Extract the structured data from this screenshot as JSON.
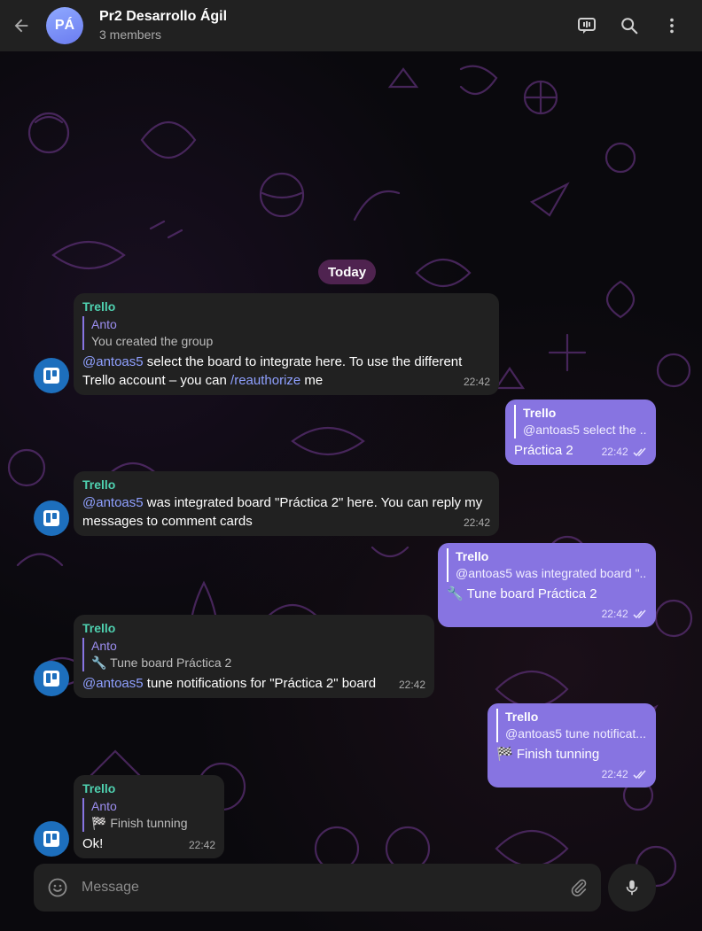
{
  "header": {
    "back_icon": "arrow-left-icon",
    "avatar_initials": "PÁ",
    "title": "Pr2 Desarrollo Ágil",
    "subtitle": "3 members",
    "actions": [
      "live-stream-icon",
      "search-icon",
      "more-vertical-icon"
    ]
  },
  "date_separator": "Today",
  "messages": [
    {
      "sender": "Trello",
      "reply_name": "Anto",
      "reply_text": "You created the group",
      "mention": "@antoas5",
      "text_a": " select the board to integrate here. To use the different Trello account – you can ",
      "command": "/reauthorize",
      "text_b": " me",
      "time": "22:42"
    },
    {
      "reply_name": "Trello",
      "reply_text": "@antoas5 select the ...",
      "text": "Práctica 2",
      "time": "22:42"
    },
    {
      "sender": "Trello",
      "mention": "@antoas5",
      "text_a": " was integrated board \"Práctica 2\" here. You can reply my messages to comment cards",
      "time": "22:42"
    },
    {
      "reply_name": "Trello",
      "reply_text": "@antoas5 was integrated board \"...",
      "text": "🔧 Tune board Práctica 2",
      "time": "22:42"
    },
    {
      "sender": "Trello",
      "reply_name": "Anto",
      "reply_text": "🔧 Tune board Práctica 2",
      "mention": "@antoas5",
      "text_a": " tune notifications for \"Práctica 2\" board",
      "time": "22:42"
    },
    {
      "reply_name": "Trello",
      "reply_text": "@antoas5 tune notificat...",
      "text": "🏁 Finish tunning",
      "time": "22:42"
    },
    {
      "sender": "Trello",
      "reply_name": "Anto",
      "reply_text": "🏁 Finish tunning",
      "text": "Ok!",
      "time": "22:42"
    }
  ],
  "composer": {
    "placeholder": "Message",
    "emoji_icon": "smile-icon",
    "attach_icon": "paperclip-icon",
    "mic_icon": "microphone-icon"
  },
  "colors": {
    "accent": "#8774e1",
    "incoming_bubble": "#212121",
    "sender_name": "#4fd1b0",
    "bot_avatar": "#1d6fbd"
  }
}
